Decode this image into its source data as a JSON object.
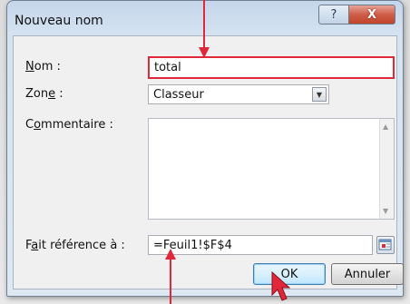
{
  "dialog": {
    "title": "Nouveau nom",
    "help_glyph": "?",
    "close_glyph": "X"
  },
  "form": {
    "nom": {
      "label_ul": "N",
      "label_rest": "om :",
      "value": "total"
    },
    "zone": {
      "label_pre": "Zon",
      "label_ul": "e",
      "label_post": " :",
      "value": "Classeur"
    },
    "commentaire": {
      "label_pre": "C",
      "label_ul": "o",
      "label_post": "mmentaire :",
      "value": ""
    },
    "reference": {
      "label_pre": "F",
      "label_ul": "a",
      "label_post": "it référence à :",
      "value": "=Feuil1!$F$4"
    }
  },
  "buttons": {
    "ok": "OK",
    "cancel": "Annuler"
  },
  "colors": {
    "annotation_red": "#e0283a",
    "title_bg": "#c4d6ea",
    "close_red": "#c2432c"
  },
  "icons": {
    "help": "question-mark-icon",
    "close": "close-x-icon",
    "dropdown": "chevron-down-icon",
    "range_selector": "collapse-dialog-icon",
    "annotation_arrows": "red-arrow-icon",
    "cursor": "mouse-pointer-icon"
  }
}
